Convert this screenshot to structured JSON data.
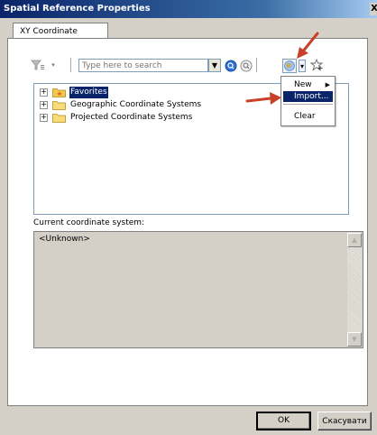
{
  "window": {
    "title": "Spatial Reference Properties",
    "close_glyph": "X"
  },
  "tabs": [
    {
      "label": "XY Coordinate System",
      "active": true
    }
  ],
  "toolbar": {
    "filter_icon": "filter-icon",
    "search_placeholder": "Type here to search",
    "search_value": "",
    "icons": [
      "search-icon",
      "clear-search-icon",
      "globe-icon",
      "dropdown-arrow-icon",
      "add-favorite-icon"
    ]
  },
  "tree": {
    "items": [
      {
        "label": "Favorites",
        "selected": true,
        "icon": "favorites-folder-icon"
      },
      {
        "label": "Geographic Coordinate Systems",
        "selected": false,
        "icon": "folder-icon"
      },
      {
        "label": "Projected Coordinate Systems",
        "selected": false,
        "icon": "folder-icon"
      }
    ]
  },
  "dropdown_menu": {
    "items": [
      {
        "label": "New",
        "has_submenu": true,
        "highlighted": false
      },
      {
        "label": "Import...",
        "has_submenu": false,
        "highlighted": true
      },
      {
        "label": "Clear",
        "has_submenu": false,
        "highlighted": false
      }
    ]
  },
  "current": {
    "label": "Current coordinate system:",
    "value": "<Unknown>"
  },
  "buttons": {
    "ok": "OK",
    "cancel": "Скасувати"
  },
  "colors": {
    "selection": "#0a246a",
    "annotation_arrow": "#c8402a",
    "dialog_background": "#d4d0c8"
  }
}
